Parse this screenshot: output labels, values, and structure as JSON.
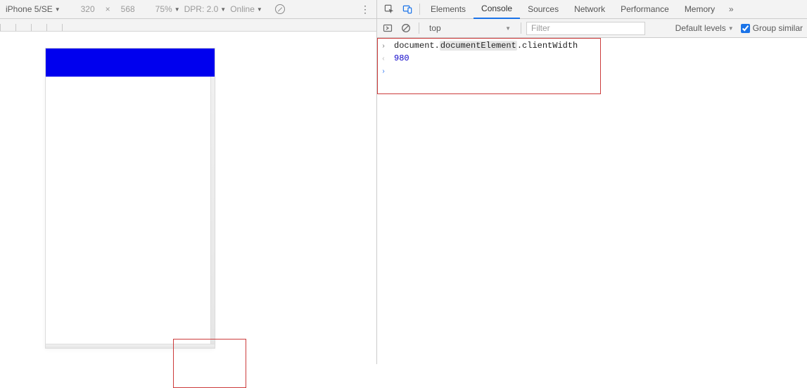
{
  "deviceToolbar": {
    "device": "iPhone 5/SE",
    "width": "320",
    "height": "568",
    "zoom": "75%",
    "dpr_label": "DPR: 2.0",
    "throttle": "Online"
  },
  "tabs": {
    "elements": "Elements",
    "console": "Console",
    "sources": "Sources",
    "network": "Network",
    "performance": "Performance",
    "memory": "Memory"
  },
  "consoleToolbar": {
    "context": "top",
    "filter_placeholder": "Filter",
    "levels": "Default levels",
    "group_similar": "Group similar"
  },
  "console": {
    "input_prefix": "document.",
    "input_highlight": "documentElement",
    "input_suffix": ".clientWidth",
    "result": "980"
  }
}
